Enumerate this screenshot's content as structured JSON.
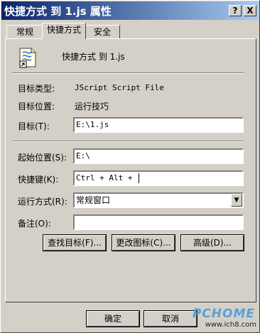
{
  "window": {
    "title": "快捷方式 到 1.js 属性"
  },
  "title_buttons": {
    "help": "?",
    "close": "X"
  },
  "tabs": [
    {
      "label": "常规"
    },
    {
      "label": "快捷方式"
    },
    {
      "label": "安全"
    }
  ],
  "shortcut": {
    "name": "快捷方式 到 1.js",
    "icon": "script-file-icon"
  },
  "fields": {
    "target_type_label": "目标类型:",
    "target_type_value": "JScript Script File",
    "target_location_label": "目标位置:",
    "target_location_value": "运行技巧",
    "target_label": "目标(T):",
    "target_value": "E:\\1.js",
    "start_in_label": "起始位置(S):",
    "start_in_value": "E:\\",
    "hotkey_label": "快捷键(K):",
    "hotkey_value": "Ctrl + Alt + ",
    "run_label": "运行方式(R):",
    "run_value": "常规窗口",
    "comment_label": "备注(O):",
    "comment_value": ""
  },
  "buttons": {
    "find_target": "查找目标(F)...",
    "change_icon": "更改图标(C)...",
    "advanced": "高级(D)...",
    "ok": "确定",
    "cancel": "取消"
  },
  "watermark": {
    "brand": "PCHOME",
    "site": "www.ich8.com"
  }
}
